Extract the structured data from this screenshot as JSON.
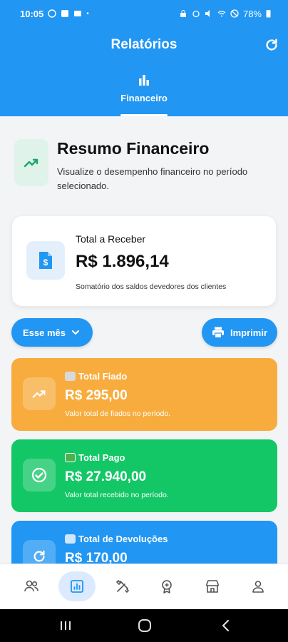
{
  "status_bar": {
    "time": "10:05",
    "battery": "78%"
  },
  "header": {
    "title": "Relatórios"
  },
  "tabs": [
    {
      "label": "Financeiro",
      "active": true
    }
  ],
  "summary": {
    "title": "Resumo Financeiro",
    "subtitle": "Visualize o desempenho financeiro no período selecionado."
  },
  "total_card": {
    "label": "Total a Receber",
    "value": "R$ 1.896,14",
    "description": "Somatório dos saldos devedores dos clientes"
  },
  "filters": {
    "period_label": "Esse mês",
    "print_label": "Imprimir"
  },
  "metrics": [
    {
      "title": "Total Fiado",
      "value": "R$ 295,00",
      "description": "Valor total de fiados no período.",
      "color": "#f8ac3e"
    },
    {
      "title": "Total Pago",
      "value": "R$ 27.940,00",
      "description": "Valor total recebido no período.",
      "color": "#14c766"
    },
    {
      "title": "Total de Devoluções",
      "value": "R$ 170,00",
      "description": "",
      "color": "#2196f3"
    }
  ],
  "bottom_nav": {
    "items": [
      {
        "icon": "users-icon"
      },
      {
        "icon": "reports-icon",
        "active": true
      },
      {
        "icon": "tools-icon"
      },
      {
        "icon": "badge-icon"
      },
      {
        "icon": "store-icon"
      },
      {
        "icon": "profile-icon"
      }
    ]
  },
  "colors": {
    "primary": "#2196f3",
    "background": "#f3f4f6"
  }
}
